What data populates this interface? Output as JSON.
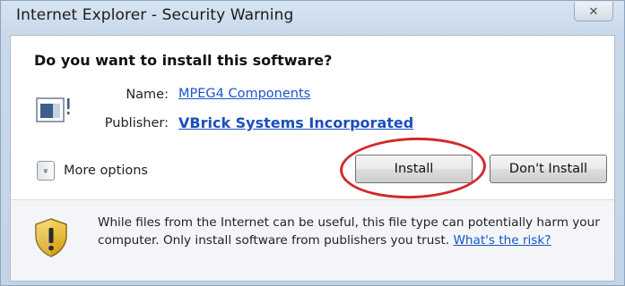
{
  "window": {
    "title": "Internet Explorer - Security Warning",
    "close_glyph": "✕"
  },
  "dialog": {
    "question": "Do you want to install this software?",
    "name_label": "Name:",
    "name_value": "MPEG4 Components",
    "publisher_label": "Publisher:",
    "publisher_value": "VBrick Systems Incorporated",
    "more_options_label": "More options",
    "more_options_chevron": "»",
    "install_label": "Install",
    "dont_install_label": "Don't Install"
  },
  "warning": {
    "text": "While files from the Internet can be useful, this file type can potentially harm your computer. Only install software from publishers you trust.",
    "link_text": "What's the risk?"
  },
  "icons": {
    "app": "software-package-icon",
    "shield": "shield-warning-icon"
  },
  "colors": {
    "link": "#1a55c8",
    "highlight": "#d12a2a",
    "shield_gold": "#e2b41a"
  }
}
